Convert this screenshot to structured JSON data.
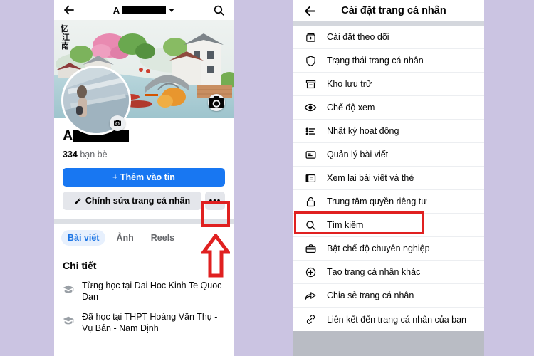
{
  "background_color": "#cbc4e2",
  "left_phone": {
    "topbar": {
      "back_icon": "back-arrow-icon",
      "title_letter": "A",
      "title_redacted": true,
      "caret_icon": "chevron-down-icon",
      "search_icon": "search-icon"
    },
    "cover": {
      "camera_icon": "camera-icon",
      "alt": "cover-photo-embroidery-village-scene"
    },
    "avatar": {
      "camera_icon": "camera-icon",
      "alt": "profile-photo-person-on-bridge"
    },
    "profile": {
      "name_letter": "A",
      "name_redacted": true,
      "friends_count": "334",
      "friends_label": "bạn bè"
    },
    "buttons": {
      "add_story": "+ Thêm vào tin",
      "edit_profile": "Chỉnh sửa trang cá nhân",
      "edit_icon": "pencil-icon",
      "more": "•••",
      "more_icon": "ellipsis-icon"
    },
    "tabs": [
      {
        "label": "Bài viết",
        "active": true
      },
      {
        "label": "Ảnh",
        "active": false
      },
      {
        "label": "Reels",
        "active": false
      }
    ],
    "details": {
      "heading": "Chi tiết",
      "rows": [
        {
          "icon": "graduation-cap-icon",
          "text": "Từng học tại Dai Hoc Kinh Te Quoc Dan"
        },
        {
          "icon": "graduation-cap-icon",
          "text": "Đã học tại THPT Hoàng Văn Thụ - Vụ Bản - Nam Định"
        }
      ]
    },
    "annotations": {
      "highlight_color": "#e02020",
      "highlight_target": "more-options-button",
      "arrow_icon": "up-arrow-annotation"
    }
  },
  "right_phone": {
    "topbar": {
      "back_icon": "back-arrow-icon",
      "title": "Cài đặt trang cá nhân"
    },
    "menu_items": [
      {
        "icon": "follow-settings-icon",
        "label": "Cài đặt theo dõi"
      },
      {
        "icon": "shield-icon",
        "label": "Trạng thái trang cá nhân"
      },
      {
        "icon": "archive-box-icon",
        "label": "Kho lưu trữ"
      },
      {
        "icon": "eye-icon",
        "label": "Chế độ xem"
      },
      {
        "icon": "activity-log-icon",
        "label": "Nhật ký hoạt động"
      },
      {
        "icon": "post-manage-icon",
        "label": "Quản lý bài viết"
      },
      {
        "icon": "review-tag-icon",
        "label": "Xem lại bài viết và thẻ"
      },
      {
        "icon": "lock-icon",
        "label": "Trung tâm quyền riêng tư"
      },
      {
        "icon": "search-icon",
        "label": "Tìm kiếm",
        "highlighted": true
      },
      {
        "icon": "briefcase-icon",
        "label": "Bật chế độ chuyên nghiệp"
      },
      {
        "icon": "plus-circle-icon",
        "label": "Tạo trang cá nhân khác"
      },
      {
        "icon": "share-arrow-icon",
        "label": "Chia sẻ trang cá nhân"
      },
      {
        "icon": "link-chain-icon",
        "label": "Liên kết đến trang cá nhân của bạn"
      }
    ],
    "annotations": {
      "highlight_color": "#e02020",
      "highlight_target": "menu-item-tim-kiem"
    }
  }
}
